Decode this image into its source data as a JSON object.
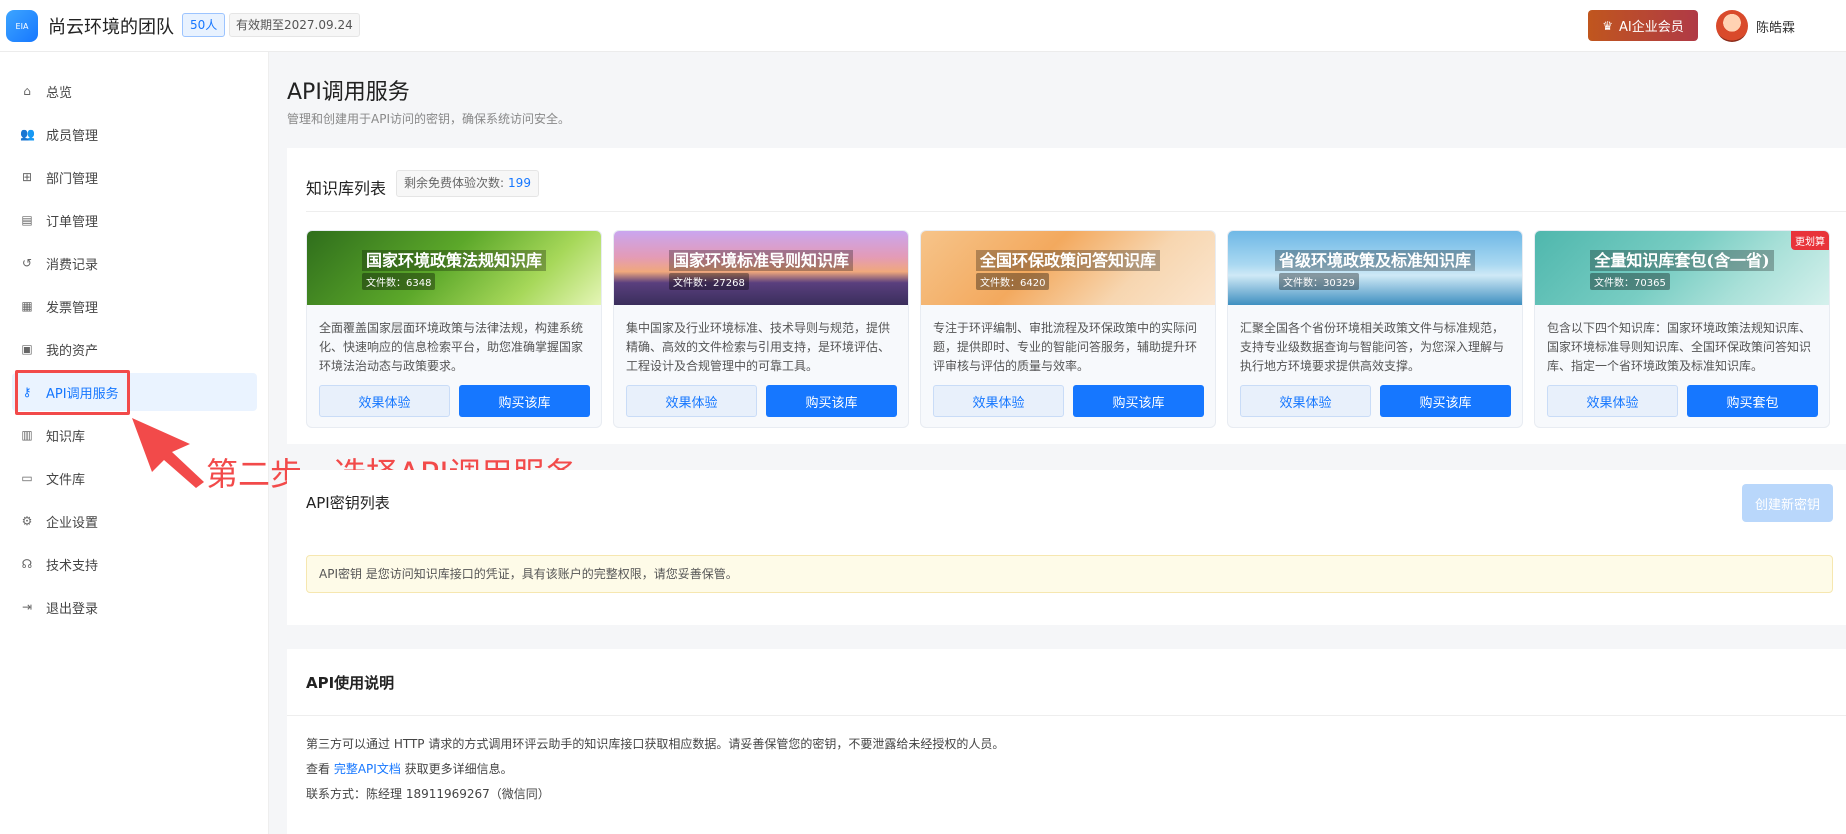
{
  "header": {
    "logo_text": "EIA",
    "team_name": "尚云环境的团队",
    "member_count": "50人",
    "expire": "有效期至2027.09.24",
    "vip_label": "AI企业会员",
    "username": "陈皓霖"
  },
  "sidebar": {
    "items": [
      {
        "label": "总览",
        "icon": "home-icon"
      },
      {
        "label": "成员管理",
        "icon": "users-icon"
      },
      {
        "label": "部门管理",
        "icon": "org-chart-icon"
      },
      {
        "label": "订单管理",
        "icon": "order-icon"
      },
      {
        "label": "消费记录",
        "icon": "history-icon"
      },
      {
        "label": "发票管理",
        "icon": "invoice-icon"
      },
      {
        "label": "我的资产",
        "icon": "asset-icon"
      },
      {
        "label": "API调用服务",
        "icon": "key-icon"
      },
      {
        "label": "知识库",
        "icon": "bar-chart-icon"
      },
      {
        "label": "文件库",
        "icon": "folder-icon"
      },
      {
        "label": "企业设置",
        "icon": "gear-icon"
      },
      {
        "label": "技术支持",
        "icon": "headset-icon"
      },
      {
        "label": "退出登录",
        "icon": "logout-icon"
      }
    ],
    "active_index": 7
  },
  "annotation": {
    "text": "第二步，选择API调用服务",
    "color": "#f24a4a"
  },
  "page": {
    "title": "API调用服务",
    "subtitle": "管理和创建用于API访问的密钥，确保系统访问安全。"
  },
  "kb_section": {
    "title": "知识库列表",
    "free_label": "剩余免费体验次数:",
    "free_count": "199",
    "cards": [
      {
        "name": "国家环境政策法规知识库",
        "count": "文件数：6348",
        "desc": "全面覆盖国家层面环境政策与法律法规，构建系统化、快速响应的信息检索平台，助您准确掌握国家环境法治动态与政策要求。",
        "try_label": "效果体验",
        "buy_label": "购买该库",
        "tag": ""
      },
      {
        "name": "国家环境标准导则知识库",
        "count": "文件数：27268",
        "desc": "集中国家及行业环境标准、技术导则与规范，提供精确、高效的文件检索与引用支持，是环境评估、工程设计及合规管理中的可靠工具。",
        "try_label": "效果体验",
        "buy_label": "购买该库",
        "tag": ""
      },
      {
        "name": "全国环保政策问答知识库",
        "count": "文件数：6420",
        "desc": "专注于环评编制、审批流程及环保政策中的实际问题，提供即时、专业的智能问答服务，辅助提升环评审核与评估的质量与效率。",
        "try_label": "效果体验",
        "buy_label": "购买该库",
        "tag": ""
      },
      {
        "name": "省级环境政策及标准知识库",
        "count": "文件数：30329",
        "desc": "汇聚全国各个省份环境相关政策文件与标准规范，支持专业级数据查询与智能问答，为您深入理解与执行地方环境要求提供高效支撑。",
        "try_label": "效果体验",
        "buy_label": "购买该库",
        "tag": ""
      },
      {
        "name": "全量知识库套包(含一省)",
        "count": "文件数：70365",
        "desc": "包含以下四个知识库：国家环境政策法规知识库、国家环境标准导则知识库、全国环保政策问答知识库、指定一个省环境政策及标准知识库。",
        "try_label": "效果体验",
        "buy_label": "购买套包",
        "tag": "更划算"
      }
    ]
  },
  "key_section": {
    "title": "API密钥列表",
    "create_label": "创建新密钥",
    "notice": "API密钥 是您访问知识库接口的凭证，具有该账户的完整权限，请您妥善保管。"
  },
  "usage_section": {
    "title": "API使用说明",
    "line1": "第三方可以通过 HTTP 请求的方式调用环评云助手的知识库接口获取相应数据。请妥善保管您的密钥，不要泄露给未经授权的人员。",
    "line2_prefix": "查看",
    "line2_link": "完整API文档",
    "line2_suffix": "获取更多详细信息。",
    "line3": "联系方式：陈经理 18911969267（微信同）"
  }
}
